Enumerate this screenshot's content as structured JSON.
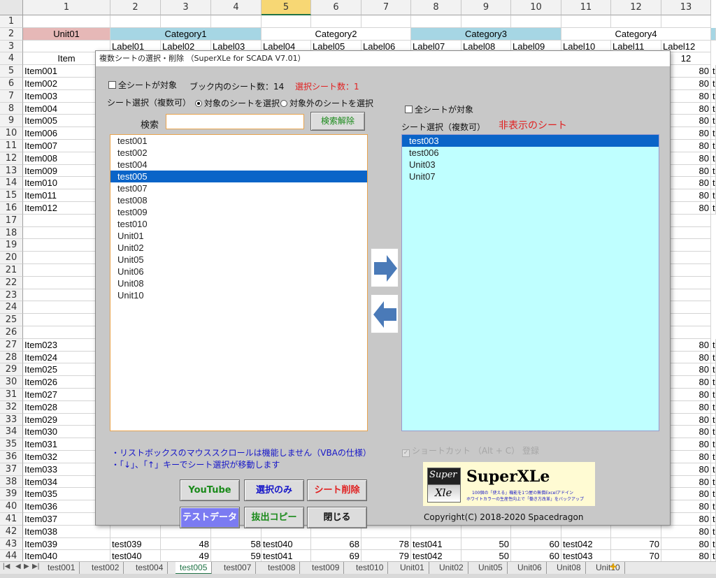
{
  "sheet": {
    "col_headers": [
      "1",
      "2",
      "3",
      "4",
      "5",
      "6",
      "7",
      "8",
      "9",
      "10",
      "11",
      "12",
      "13"
    ],
    "selected_col": "5",
    "row_numbers": [
      "1",
      "2",
      "3",
      "4",
      "5",
      "6",
      "7",
      "8",
      "9",
      "10",
      "11",
      "12",
      "13",
      "14",
      "15",
      "16",
      "17",
      "18",
      "19",
      "20",
      "21",
      "22",
      "23",
      "24",
      "25",
      "26",
      "27",
      "28",
      "29",
      "30",
      "31",
      "32",
      "33",
      "34",
      "35",
      "36",
      "37",
      "38",
      "39",
      "40",
      "41",
      "42",
      "43",
      "44"
    ],
    "unit_cell": "Unit01",
    "categories": [
      "Category1",
      "Category2",
      "Category3",
      "Category4"
    ],
    "labels": [
      "Label01",
      "Label02",
      "Label03",
      "Label04",
      "Label05",
      "Label06",
      "Label07",
      "Label08",
      "Label09",
      "Label10",
      "Label11",
      "Label12"
    ],
    "item_header": "Item",
    "filter_12": "12",
    "items_top": [
      "Item001",
      "Item002",
      "Item003",
      "Item004",
      "Item005",
      "Item006",
      "Item007",
      "Item008",
      "Item009",
      "Item010",
      "Item011",
      "Item012"
    ],
    "items_bottom": [
      "Item023",
      "Item024",
      "Item025",
      "Item026",
      "Item027",
      "Item028",
      "Item029",
      "Item030",
      "Item031",
      "Item032",
      "Item033",
      "Item034",
      "Item035",
      "Item036",
      "Item037",
      "Item038",
      "Item039",
      "Item040"
    ],
    "right_value": "80",
    "right_text": "t",
    "row43": {
      "c2": "test039",
      "c3": "48",
      "c4": "58",
      "c4t": "test040",
      "c6": "68",
      "c7": "78",
      "c7t": "test041",
      "c9": "50",
      "c10": "60",
      "c10t": "test042",
      "c12": "70"
    },
    "row44": {
      "c2": "test040",
      "c3": "49",
      "c4": "59",
      "c4t": "test041",
      "c6": "69",
      "c7": "79",
      "c7t": "test042",
      "c9": "50",
      "c10": "60",
      "c10t": "test043",
      "c12": "70"
    }
  },
  "tabs": [
    "test001",
    "test002",
    "test004",
    "test005",
    "test007",
    "test008",
    "test009",
    "test010",
    "Unit01",
    "Unit02",
    "Unit05",
    "Unit06",
    "Unit08",
    "Unit10"
  ],
  "active_tab": "test005",
  "dialog": {
    "title": "複数シートの選択・削除 （SuperXLe for SCADA V7.01）",
    "all_sheets_left": "全シートが対象",
    "sheet_count": "ブック内のシート数：14",
    "selected_count": "選択シート数：1",
    "sheet_select_left": "シート選択（複数可）",
    "radio_target": "対象のシートを選択",
    "radio_non_target": "対象外のシートを選択",
    "search_label": "検索",
    "search_value": "",
    "search_clear": "検索解除",
    "left_list": [
      "test001",
      "test002",
      "test004",
      "test005",
      "test007",
      "test008",
      "test009",
      "test010",
      "Unit01",
      "Unit02",
      "Unit05",
      "Unit06",
      "Unit08",
      "Unit10"
    ],
    "left_selected": "test005",
    "all_sheets_right": "全シートが対象",
    "sheet_select_right": "シート選択（複数可）",
    "hidden_sheets": "非表示のシート",
    "right_list": [
      "test003",
      "test006",
      "Unit03",
      "Unit07"
    ],
    "right_selected": "test003",
    "note1": "・リストボックスのマウススクロールは機能しません（VBAの仕様）",
    "note2": "・「↓」、「↑」キーでシート選択が移動します",
    "shortcut": "ショートカット （Alt + C） 登録",
    "buttons": {
      "youtube": "YouTube",
      "select_only": "選択のみ",
      "delete": "シート削除",
      "test_data": "テストデータ",
      "extract_copy": "抜出コピー",
      "close": "閉じる"
    },
    "logo": {
      "badge_top": "Super",
      "badge_bottom": "Xle",
      "name": "SuperXLe",
      "tag1": "100個の「使える」機能を1つ屋の無償Excelアドイン",
      "tag2": "ホワイトカラーの生産性向上で「働き方改革」をバックアップ"
    },
    "copyright": "Copyright(C) 2018-2020 Spacedragon",
    "colors": {
      "accent_blue": "#0a64c8",
      "right_list_bg": "#bfffff",
      "red": "#e02020",
      "green_text": "#1a8a1a"
    }
  }
}
